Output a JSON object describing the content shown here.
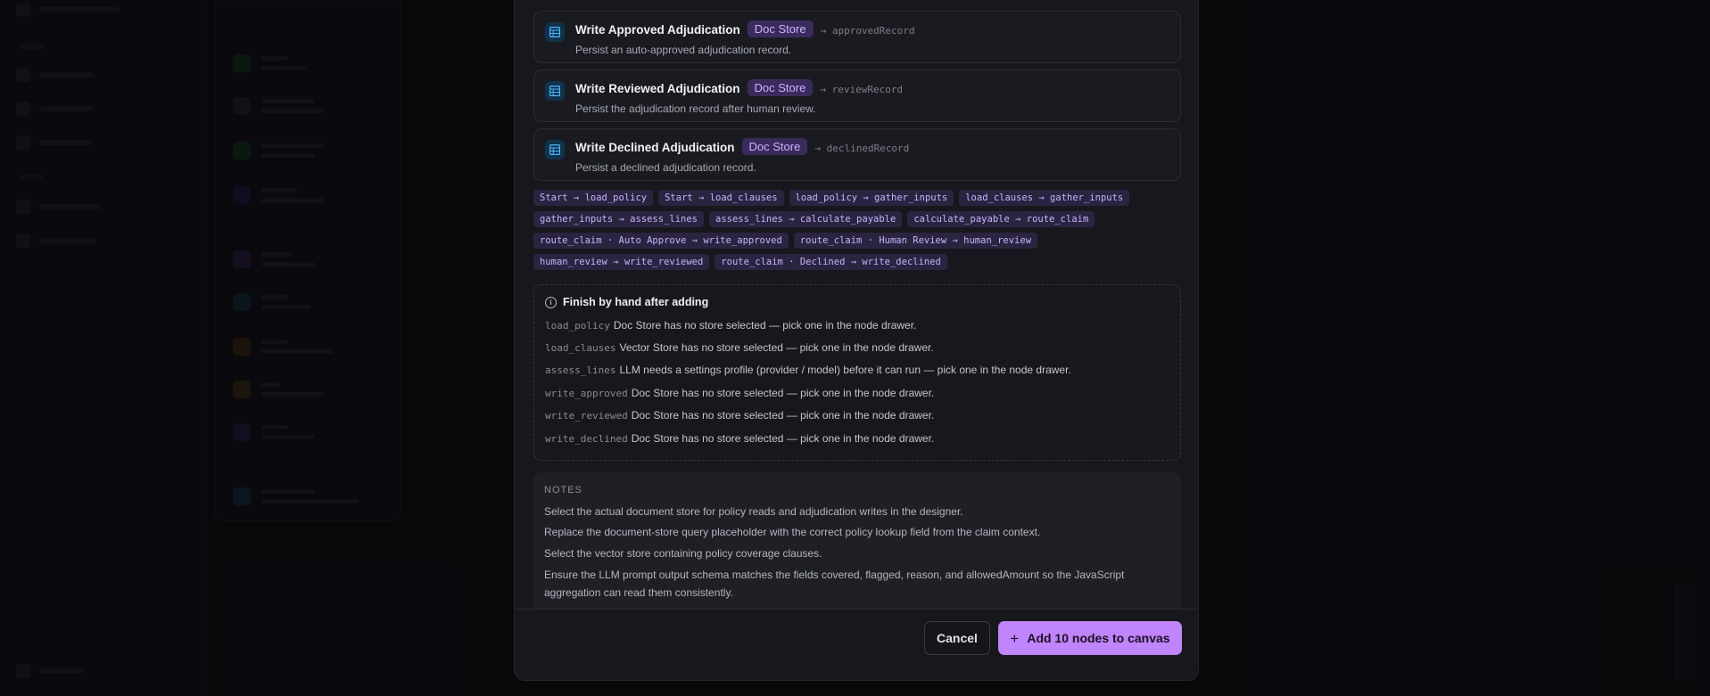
{
  "steps": [
    {
      "title": "Write Approved Adjudication",
      "badge": "Doc Store",
      "output": "→ approvedRecord",
      "desc": "Persist an auto-approved adjudication record."
    },
    {
      "title": "Write Reviewed Adjudication",
      "badge": "Doc Store",
      "output": "→ reviewRecord",
      "desc": "Persist the adjudication record after human review."
    },
    {
      "title": "Write Declined Adjudication",
      "badge": "Doc Store",
      "output": "→ declinedRecord",
      "desc": "Persist a declined adjudication record."
    }
  ],
  "edges": [
    [
      "Start → load_policy",
      "Start → load_clauses",
      "load_policy → gather_inputs",
      "load_clauses → gather_inputs"
    ],
    [
      "gather_inputs → assess_lines",
      "assess_lines → calculate_payable",
      "calculate_payable → route_claim"
    ],
    [
      "route_claim · Auto Approve → write_approved",
      "route_claim · Human Review → human_review"
    ],
    [
      "human_review → write_reviewed",
      "route_claim · Declined → write_declined"
    ]
  ],
  "todo": {
    "title": "Finish by hand after adding",
    "items": [
      {
        "node": "load_policy",
        "text": "Doc Store has no store selected — pick one in the node drawer."
      },
      {
        "node": "load_clauses",
        "text": "Vector Store has no store selected — pick one in the node drawer."
      },
      {
        "node": "assess_lines",
        "text": "LLM needs a settings profile (provider / model) before it can run — pick one in the node drawer."
      },
      {
        "node": "write_approved",
        "text": "Doc Store has no store selected — pick one in the node drawer."
      },
      {
        "node": "write_reviewed",
        "text": "Doc Store has no store selected — pick one in the node drawer."
      },
      {
        "node": "write_declined",
        "text": "Doc Store has no store selected — pick one in the node drawer."
      }
    ]
  },
  "notes": {
    "title": "NOTES",
    "items": [
      "Select the actual document store for policy reads and adjudication writes in the designer.",
      "Replace the document-store query placeholder with the correct policy lookup field from the claim context.",
      "Select the vector store containing policy coverage clauses.",
      "Ensure the LLM prompt output schema matches the fields covered, flagged, reason, and allowedAmount so the JavaScript aggregation can read them consistently."
    ]
  },
  "footer": {
    "cancel_label": "Cancel",
    "add_label": "Add 10 nodes to canvas"
  },
  "colors": {
    "accent": "#c084fc",
    "badge_bg": "#3b2b5c",
    "badge_text": "#c9b3ff",
    "edge_chip_bg": "#2b2440",
    "edge_chip_text": "#c4b5fd"
  },
  "icons": {
    "step": "table-icon",
    "todo": "info-icon",
    "add": "plus-icon"
  }
}
